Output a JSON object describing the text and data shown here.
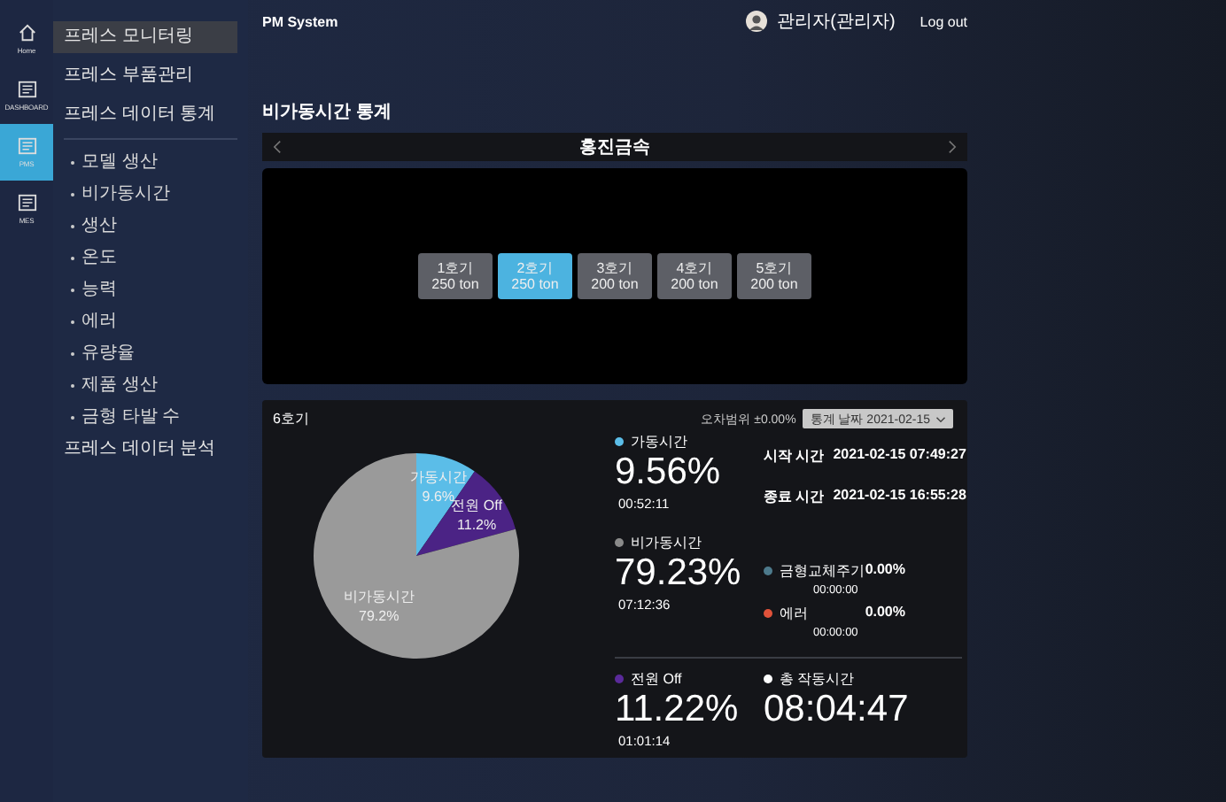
{
  "rail": [
    {
      "label": "Home",
      "selected": false
    },
    {
      "label": "DASHBOARD",
      "selected": false
    },
    {
      "label": "PMS",
      "selected": true
    },
    {
      "label": "MES",
      "selected": false
    }
  ],
  "nav": [
    {
      "label": "프레스 모니터링",
      "selected": true
    },
    {
      "label": "프레스 부품관리",
      "selected": false
    },
    {
      "label": "프레스 데이터 통계",
      "selected": false,
      "children": [
        {
          "label": "모델 생산",
          "selected": false
        },
        {
          "label": "비가동시간",
          "selected": false
        },
        {
          "label": "생산",
          "selected": false
        },
        {
          "label": "온도",
          "selected": false
        },
        {
          "label": "능력",
          "selected": false
        },
        {
          "label": "에러",
          "selected": false
        },
        {
          "label": "유량율",
          "selected": false
        },
        {
          "label": "제품 생산",
          "selected": false
        },
        {
          "label": "금형 타발 수",
          "selected": false
        }
      ]
    },
    {
      "label": "프레스 데이터 분석",
      "selected": false
    }
  ],
  "header": {
    "title": "PM System",
    "user": "관리자(관리자)",
    "logout": "Log out"
  },
  "page_title": "비가동시간 통계",
  "carousel": {
    "title": "홍진금속"
  },
  "machines": [
    {
      "name": "1호기",
      "capacity": "250 ton",
      "selected": false
    },
    {
      "name": "2호기",
      "capacity": "250 ton",
      "selected": true
    },
    {
      "name": "3호기",
      "capacity": "200 ton",
      "selected": false
    },
    {
      "name": "4호기",
      "capacity": "200 ton",
      "selected": false
    },
    {
      "name": "5호기",
      "capacity": "200 ton",
      "selected": false
    }
  ],
  "stats": {
    "title": "6호기",
    "tolerance": "오차범위 ±0.00%",
    "date_select": "통계 날짜 2021-02-15",
    "chart_data": {
      "type": "pie",
      "categories": [
        "가동시간",
        "전원 Off",
        "비가동시간"
      ],
      "series": [
        {
          "colors": [
            "#5bbde8",
            "#4b2385",
            "#9a9a9a"
          ],
          "values": [
            9.6,
            11.2,
            79.2
          ]
        }
      ],
      "value_labels": [
        "9.6%",
        "11.2%",
        "79.2%"
      ]
    },
    "primary": [
      {
        "label": "가동시간",
        "color": "#5bbde8",
        "percent": "9.56%",
        "time": "00:52:11"
      },
      {
        "label": "비가동시간",
        "color": "#8a8a8a",
        "percent": "79.23%",
        "time": "07:12:36"
      },
      {
        "label": "전원 Off",
        "color": "#5a2a9a",
        "percent": "11.22%",
        "time": "01:01:14"
      }
    ],
    "times": [
      {
        "label": "시작 시간",
        "value": "2021-02-15 07:49:27"
      },
      {
        "label": "종료 시간",
        "value": "2021-02-15 16:55:28"
      }
    ],
    "minor": [
      {
        "label": "금형교체주기",
        "color": "#4d7a8c",
        "percent": "0.00%",
        "time": "00:00:00"
      },
      {
        "label": "에러",
        "color": "#e0523a",
        "percent": "0.00%",
        "time": "00:00:00"
      }
    ],
    "total": {
      "label": "총 작동시간",
      "value": "08:04:47"
    }
  }
}
